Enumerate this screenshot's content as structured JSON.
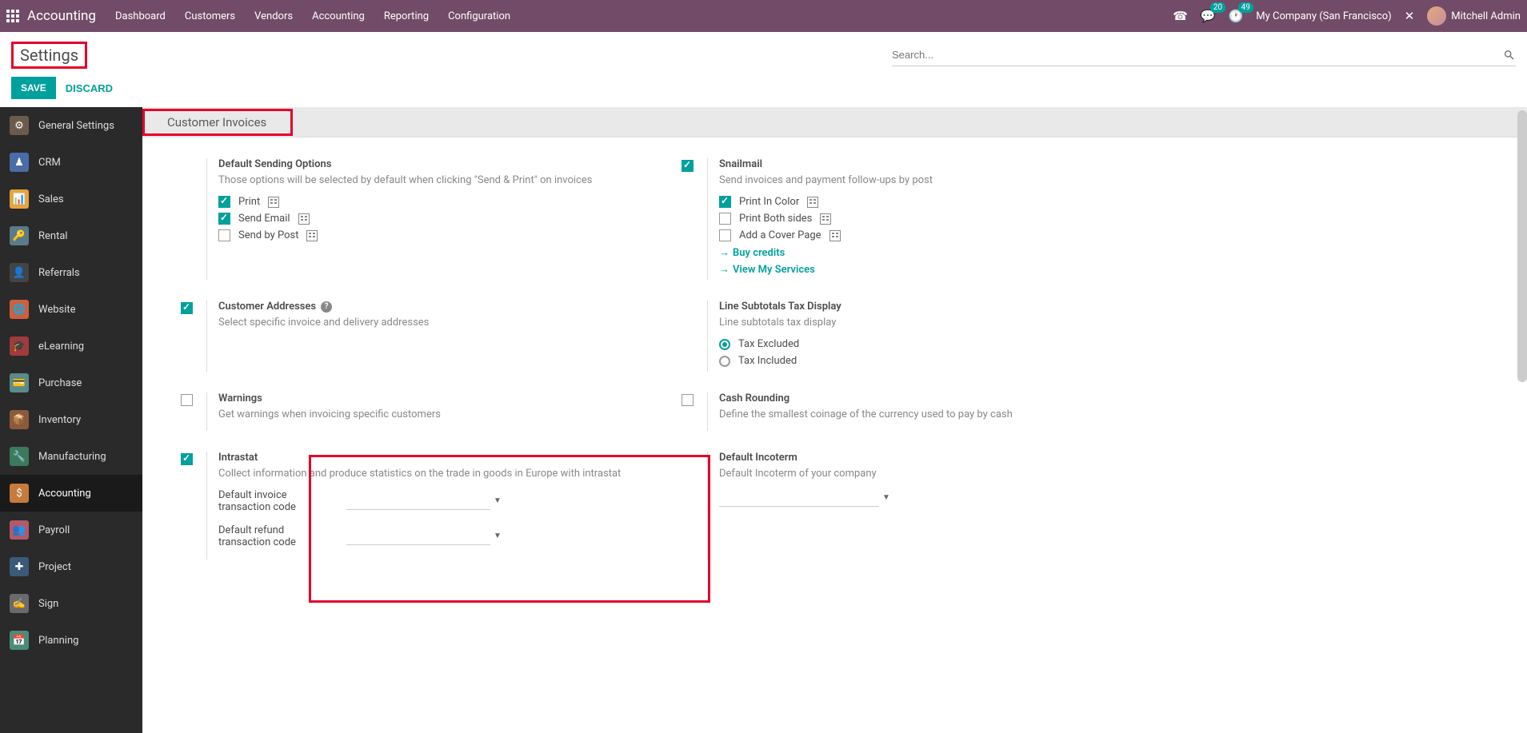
{
  "navbar": {
    "brand": "Accounting",
    "menu": [
      "Dashboard",
      "Customers",
      "Vendors",
      "Accounting",
      "Reporting",
      "Configuration"
    ],
    "messages_badge": "20",
    "activities_badge": "49",
    "company": "My Company (San Francisco)",
    "user": "Mitchell Admin"
  },
  "page": {
    "title": "Settings",
    "search_placeholder": "Search...",
    "save": "SAVE",
    "discard": "DISCARD"
  },
  "sidebar": {
    "items": [
      {
        "label": "General Settings"
      },
      {
        "label": "CRM"
      },
      {
        "label": "Sales"
      },
      {
        "label": "Rental"
      },
      {
        "label": "Referrals"
      },
      {
        "label": "Website"
      },
      {
        "label": "eLearning"
      },
      {
        "label": "Purchase"
      },
      {
        "label": "Inventory"
      },
      {
        "label": "Manufacturing"
      },
      {
        "label": "Accounting"
      },
      {
        "label": "Payroll"
      },
      {
        "label": "Project"
      },
      {
        "label": "Sign"
      },
      {
        "label": "Planning"
      }
    ]
  },
  "section": {
    "title": "Customer Invoices"
  },
  "settings": {
    "default_sending": {
      "label": "Default Sending Options",
      "desc": "Those options will be selected by default when clicking \"Send & Print\" on invoices",
      "print": "Print",
      "send_email": "Send Email",
      "send_post": "Send by Post"
    },
    "snailmail": {
      "label": "Snailmail",
      "desc": "Send invoices and payment follow-ups by post",
      "print_color": "Print In Color",
      "print_both": "Print Both sides",
      "cover": "Add a Cover Page",
      "buy": "Buy credits",
      "services": "View My Services"
    },
    "addresses": {
      "label": "Customer Addresses",
      "desc": "Select specific invoice and delivery addresses"
    },
    "tax_display": {
      "label": "Line Subtotals Tax Display",
      "desc": "Line subtotals tax display",
      "excluded": "Tax Excluded",
      "included": "Tax Included"
    },
    "warnings": {
      "label": "Warnings",
      "desc": "Get warnings when invoicing specific customers"
    },
    "cash_rounding": {
      "label": "Cash Rounding",
      "desc": "Define the smallest coinage of the currency used to pay by cash"
    },
    "intrastat": {
      "label": "Intrastat",
      "desc": "Collect information and produce statistics on the trade in goods in Europe with intrastat",
      "inv_code": "Default invoice transaction code",
      "ref_code": "Default refund transaction code"
    },
    "incoterm": {
      "label": "Default Incoterm",
      "desc": "Default Incoterm of your company"
    }
  }
}
